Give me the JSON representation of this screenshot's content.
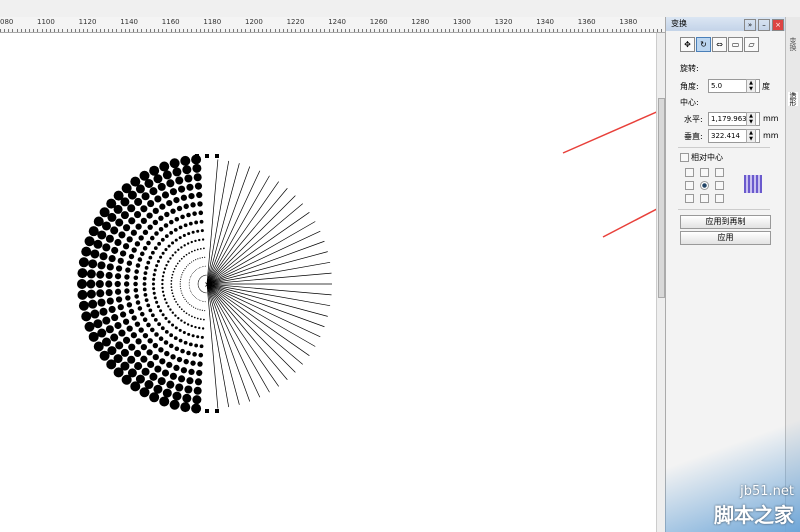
{
  "ruler": {
    "labels": [
      "080",
      "1100",
      "1120",
      "1140",
      "1160",
      "1180",
      "1200",
      "1220",
      "1240",
      "1260",
      "1280",
      "1300",
      "1320",
      "1340",
      "1360",
      "1380"
    ]
  },
  "panel": {
    "title": "变换",
    "section_rotate": "旋转:",
    "angle_label": "角度:",
    "angle_value": "5.0",
    "angle_unit": "度",
    "center_label": "中心:",
    "h_label": "水平:",
    "h_value": "1,179.963",
    "h_unit": "mm",
    "v_label": "垂直:",
    "v_value": "322.414",
    "v_unit": "mm",
    "relative_center": "相对中心",
    "relative_center_checked": false,
    "anchor_selected": "center",
    "apply_copy": "应用到再制",
    "apply": "应用"
  },
  "side_tabs": [
    "变换",
    "造形"
  ],
  "watermark": {
    "site": "jb51.net",
    "name": "脚本之家"
  },
  "colors": {
    "arrow": "#e8403a",
    "panel_title": "#c3d3e8"
  }
}
